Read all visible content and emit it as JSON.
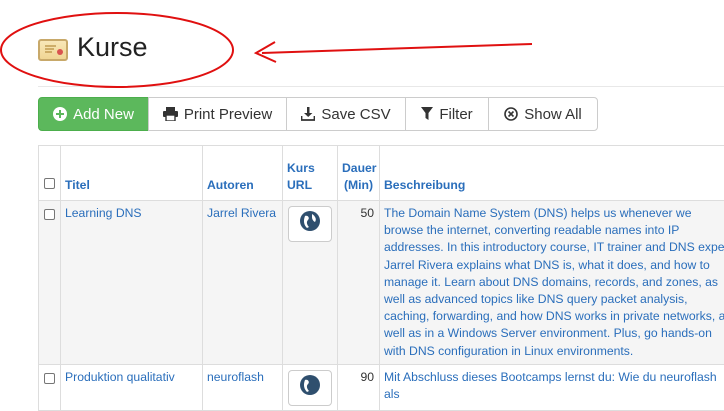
{
  "page": {
    "title": "Kurse",
    "title_icon": "certificate-icon"
  },
  "toolbar": {
    "add_new": "Add New",
    "print_preview": "Print Preview",
    "save_csv": "Save CSV",
    "filter": "Filter",
    "show_all": "Show All",
    "accent_color": "#5cb85c"
  },
  "table": {
    "headers": {
      "title": "Titel",
      "authors": "Autoren",
      "url": "Kurs URL",
      "duration": "Dauer (Min)",
      "description": "Beschreibung"
    },
    "rows": [
      {
        "title": "Learning DNS",
        "authors": "Jarrel Rivera",
        "duration": "50",
        "description": "The Domain Name System (DNS) helps us whenever we browse the internet, converting readable names into IP addresses. In this introductory course, IT trainer and DNS expert Jarrel Rivera explains what DNS is, what it does, and how to manage it. Learn about DNS domains, records, and zones, as well as advanced topics like DNS query packet analysis, caching, forwarding, and how DNS works in private networks, as well as in a Windows Server environment. Plus, go hands-on with DNS configuration in Linux environments."
      },
      {
        "title": "Produktion qualitativ",
        "authors": "neuroflash",
        "duration": "90",
        "description": "Mit Abschluss dieses Bootcamps lernst du: Wie du neuroflash als"
      }
    ]
  },
  "colors": {
    "link": "#2a6ebb",
    "annotation": "#e01010"
  }
}
